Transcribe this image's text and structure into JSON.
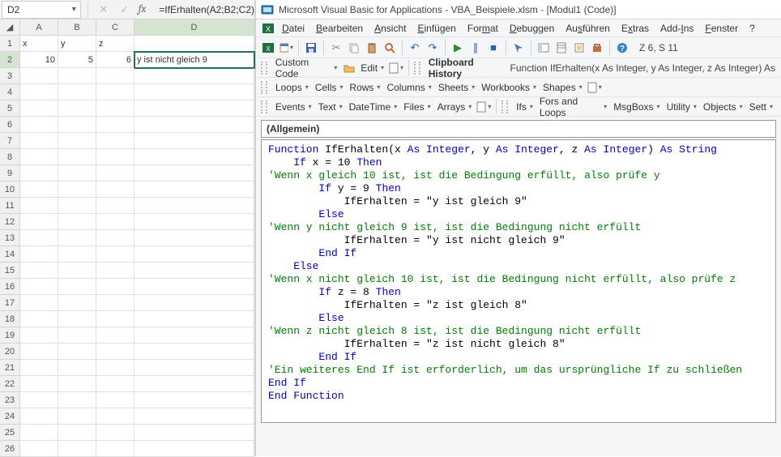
{
  "excel": {
    "namebox": "D2",
    "formula": "=IfErhalten(A2;B2;C2)",
    "columns": [
      "A",
      "B",
      "C",
      "D"
    ],
    "row_numbers": [
      "1",
      "2",
      "3",
      "4",
      "5",
      "6",
      "7",
      "8",
      "9",
      "10",
      "11",
      "12",
      "13",
      "14",
      "15",
      "16",
      "17",
      "18",
      "19",
      "20",
      "21",
      "22",
      "23",
      "24",
      "25",
      "26"
    ],
    "headers": {
      "A": "x",
      "B": "y",
      "C": "z",
      "D": ""
    },
    "row2": {
      "A": "10",
      "B": "5",
      "C": "6",
      "D": "y ist nicht gleich 9"
    }
  },
  "vba": {
    "title": "Microsoft Visual Basic for Applications - VBA_Beispiele.xlsm - [Modul1 (Code)]",
    "menus": [
      "Datei",
      "Bearbeiten",
      "Ansicht",
      "Einfügen",
      "Format",
      "Debuggen",
      "Ausführen",
      "Extras",
      "Add-Ins",
      "Fenster",
      "?"
    ],
    "pos": "Z 6, S 11",
    "tb2": {
      "custom": "Custom Code",
      "edit": "Edit",
      "clip": "Clipboard History",
      "sig": "Function IfErhalten(x As Integer, y As Integer, z As Integer) As Stri"
    },
    "tb3a": [
      "Loops",
      "Cells",
      "Rows",
      "Columns",
      "Sheets",
      "Workbooks",
      "Shapes"
    ],
    "tb4a": [
      "Events",
      "Text",
      "DateTime",
      "Files",
      "Arrays"
    ],
    "tb4b": [
      "Ifs",
      "Fors and Loops",
      "MsgBoxs",
      "Utility",
      "Objects",
      "Sett"
    ],
    "drop": "(Allgemein)"
  },
  "code": {
    "l1a": "Function ",
    "l1b": "IfErhalten(x ",
    "l1c": "As Integer",
    "l1d": ", y ",
    "l1e": "As Integer",
    "l1f": ", z ",
    "l1g": "As Integer",
    "l1h": ") ",
    "l1i": "As String",
    "l2a": "    If ",
    "l2b": "x = 10 ",
    "l2c": "Then",
    "l3": "'Wenn x gleich 10 ist, ist die Bedingung erfüllt, also prüfe y",
    "l4a": "        If ",
    "l4b": "y = 9 ",
    "l4c": "Then",
    "l5": "            IfErhalten = \"y ist gleich 9\"",
    "l6": "        Else",
    "l7": "'Wenn y nicht gleich 9 ist, ist die Bedingung nicht erfüllt",
    "l8": "            IfErhalten = \"y ist nicht gleich 9\"",
    "l9": "        End If",
    "l10": "    Else",
    "l11": "'Wenn x nicht gleich 10 ist, ist die Bedingung nicht erfüllt, also prüfe z",
    "l12a": "        If ",
    "l12b": "z = 8 ",
    "l12c": "Then",
    "l13": "            IfErhalten = \"z ist gleich 8\"",
    "l14": "        Else",
    "l15": "'Wenn z nicht gleich 8 ist, ist die Bedingung nicht erfüllt",
    "l16": "            IfErhalten = \"z ist nicht gleich 8\"",
    "l17": "        End If",
    "l18": "'Ein weiteres End If ist erforderlich, um das ursprüngliche If zu schließen",
    "l19": "End If",
    "l20": "End Function"
  }
}
